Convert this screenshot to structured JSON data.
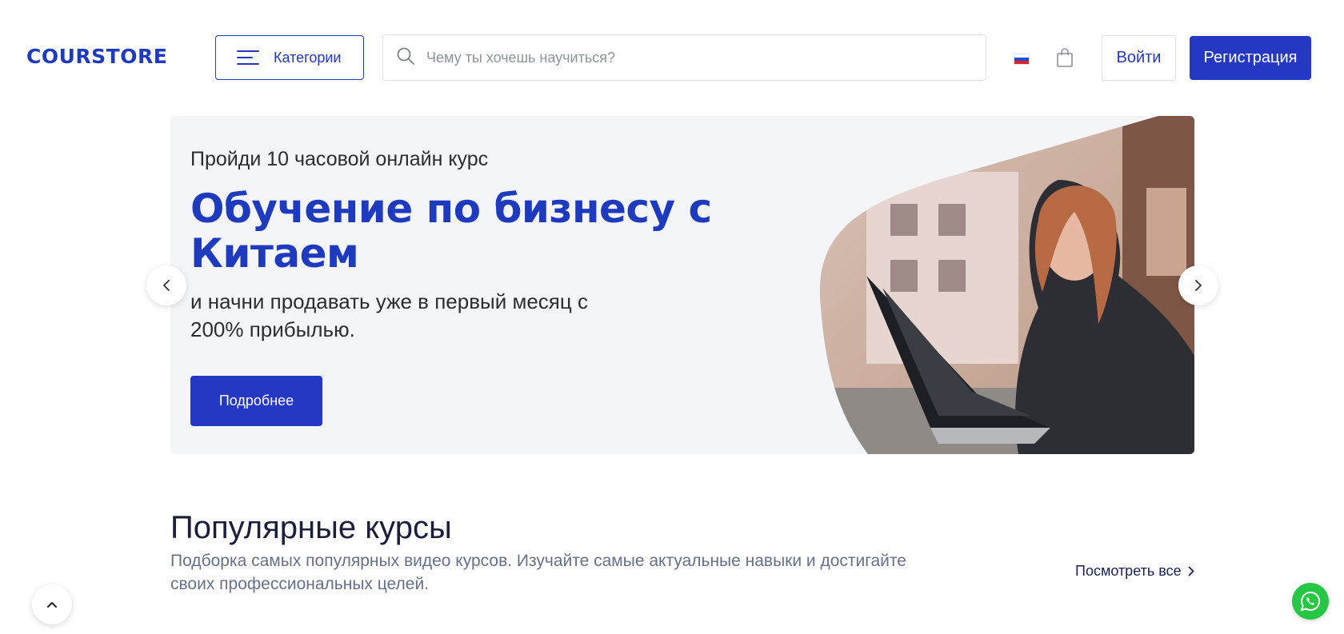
{
  "header": {
    "logo": "COURSTORE",
    "categories_label": "Категории",
    "search_placeholder": "Чему ты хочешь научиться?",
    "language": "ru",
    "login_label": "Войти",
    "register_label": "Регистрация"
  },
  "banner": {
    "pretitle": "Пройди 10 часовой онлайн курс",
    "title": "Обучение по бизнесу с Китаем",
    "subtitle": "и начни продавать уже в первый месяц с 200% прибылью.",
    "cta_label": "Подробнее"
  },
  "popular": {
    "title": "Популярные курсы",
    "description": "Подборка самых популярных видео курсов. Изучайте самые актуальные навыки и достигайте своих профессиональных целей.",
    "view_all_label": "Посмотреть все"
  },
  "icons": {
    "menu": "hamburger-icon",
    "search": "search-icon",
    "flag": "russian-flag-icon",
    "cart": "shopping-bag-icon",
    "prev": "chevron-left-icon",
    "next": "chevron-right-icon",
    "view_all": "chevron-right-icon",
    "scroll_top": "chevron-up-icon",
    "chat": "whatsapp-icon"
  },
  "colors": {
    "brand": "#2438c4",
    "banner_bg": "#f4f5f8",
    "whatsapp": "#25c744"
  }
}
